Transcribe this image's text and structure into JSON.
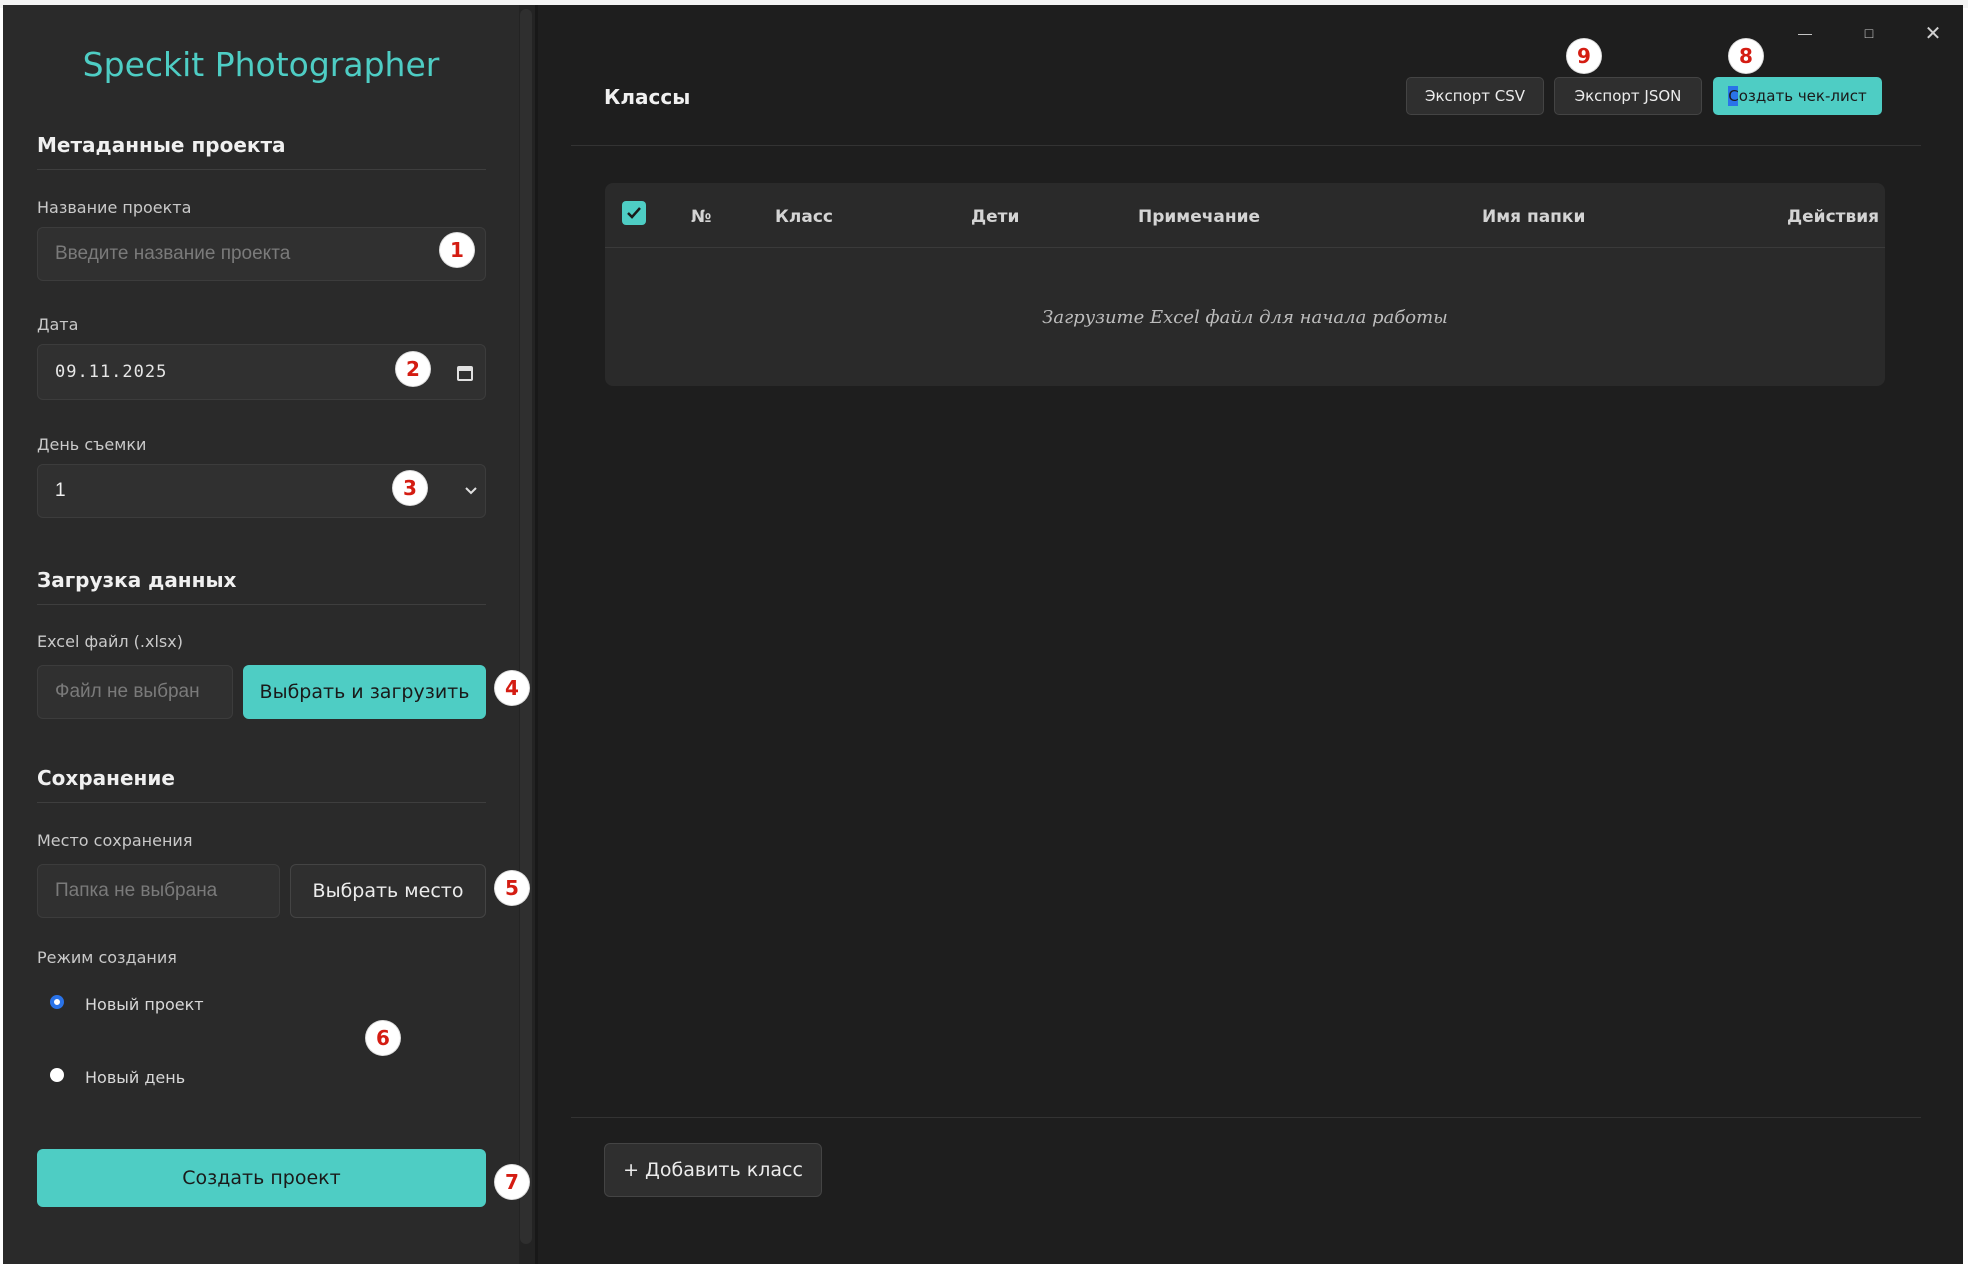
{
  "app": {
    "title": "Speckit Photographer",
    "window_controls": {
      "minimize": "—",
      "maximize": "□",
      "close": "✕"
    }
  },
  "sidebar": {
    "metadata": {
      "section_title": "Метаданные проекта",
      "project_name_label": "Название проекта",
      "project_name_placeholder": "Введите название проекта",
      "date_label": "Дата",
      "date_value": "09.11.2025",
      "shoot_day_label": "День съемки",
      "shoot_day_value": "1"
    },
    "upload": {
      "section_title": "Загрузка данных",
      "excel_label": "Excel файл (.xlsx)",
      "file_placeholder": "Файл не выбран",
      "choose_upload_button": "Выбрать и загрузить"
    },
    "save": {
      "section_title": "Сохранение",
      "location_label": "Место сохранения",
      "folder_placeholder": "Папка не выбрана",
      "choose_location_button": "Выбрать место",
      "mode_label": "Режим создания",
      "modes": [
        {
          "label": "Новый проект",
          "selected": true
        },
        {
          "label": "Новый день",
          "selected": false
        }
      ]
    },
    "create_project_button": "Создать проект"
  },
  "main": {
    "title": "Классы",
    "toolbar": {
      "export_csv": "Экспорт CSV",
      "export_json": "Экспорт JSON",
      "create_checklist": "Создать чек-лист"
    },
    "table": {
      "select_all_checked": true,
      "columns": [
        "№",
        "Класс",
        "Дети",
        "Примечание",
        "Имя папки",
        "Действия"
      ],
      "empty_message": "Загрузите Excel файл для начала работы"
    },
    "add_class_button": "+ Добавить класс"
  },
  "annotations": [
    "1",
    "2",
    "3",
    "4",
    "5",
    "6",
    "7",
    "8",
    "9"
  ],
  "colors": {
    "accent": "#4ecdc4",
    "badge_text": "#d41c12",
    "radio_selected": "#2a73e8"
  }
}
